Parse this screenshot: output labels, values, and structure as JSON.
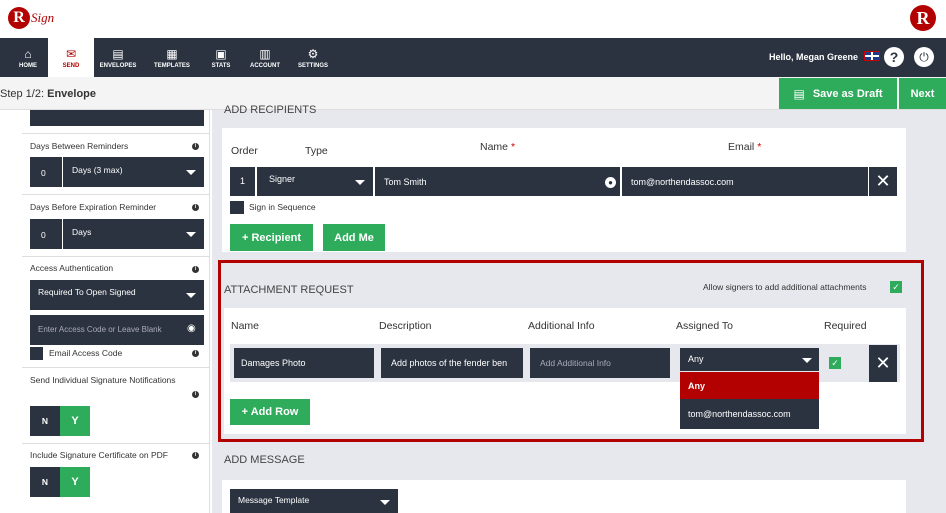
{
  "brand": {
    "logo_letter": "R",
    "logo_text": "Sign",
    "right_logo_letter": "R"
  },
  "nav": {
    "items": [
      {
        "label": "HOME",
        "icon": "home-icon",
        "glyph": "⌂"
      },
      {
        "label": "SEND",
        "icon": "envelope-icon",
        "glyph": "✉"
      },
      {
        "label": "ENVELOPES",
        "icon": "envelopes-icon",
        "glyph": "▤"
      },
      {
        "label": "TEMPLATES",
        "icon": "templates-icon",
        "glyph": "▦"
      },
      {
        "label": "STATS",
        "icon": "stats-icon",
        "glyph": "▣"
      },
      {
        "label": "ACCOUNT",
        "icon": "account-icon",
        "glyph": "▥"
      },
      {
        "label": "SETTINGS",
        "icon": "gear-icon",
        "glyph": "⚙"
      }
    ],
    "greeting": "Hello, Megan Greene",
    "help": "?",
    "power": "⏻"
  },
  "step": {
    "prefix": "Step 1/2:",
    "title": "Envelope"
  },
  "actions": {
    "save_draft": "Save as Draft",
    "next": "Next"
  },
  "left": {
    "reminders_label": "Days Between Reminders",
    "reminders_value": "0",
    "reminders_unit": "Days (3 max)",
    "expiration_label": "Days Before Expiration Reminder",
    "expiration_value": "0",
    "expiration_unit": "Days",
    "access_label": "Access Authentication",
    "access_value": "Required To Open Signed",
    "access_placeholder": "Enter Access Code or Leave Blank",
    "email_access_code": "Email Access Code",
    "individual_label": "Send Individual Signature Notifications",
    "n": "N",
    "y": "Y",
    "certificate_label": "Include Signature Certificate on PDF"
  },
  "recipients": {
    "header": "ADD RECIPIENTS",
    "columns": {
      "order": "Order",
      "type": "Type",
      "name": "Name",
      "email": "Email",
      "req": "*"
    },
    "row": {
      "order": "1",
      "type": "Signer",
      "name": "Tom Smith",
      "email": "tom@northendassoc.com"
    },
    "sequence": "Sign in Sequence",
    "add_recipient": "+ Recipient",
    "add_me": "Add Me"
  },
  "attachment": {
    "header": "ATTACHMENT REQUEST",
    "allow_label": "Allow signers to add additional attachments",
    "columns": {
      "name": "Name",
      "description": "Description",
      "additional": "Additional Info",
      "assigned": "Assigned To",
      "required": "Required"
    },
    "row": {
      "name": "Damages Photo",
      "description": "Add photos of the fender ben",
      "additional_placeholder": "Add Additional Info",
      "assigned": "Any"
    },
    "dropdown_options": [
      "Any",
      "tom@northendassoc.com"
    ],
    "add_row": "+ Add Row"
  },
  "message": {
    "header": "ADD MESSAGE",
    "template": "Message Template"
  },
  "colors": {
    "accent": "#b30000",
    "green": "#2eac5c",
    "dark": "#2b3340"
  }
}
